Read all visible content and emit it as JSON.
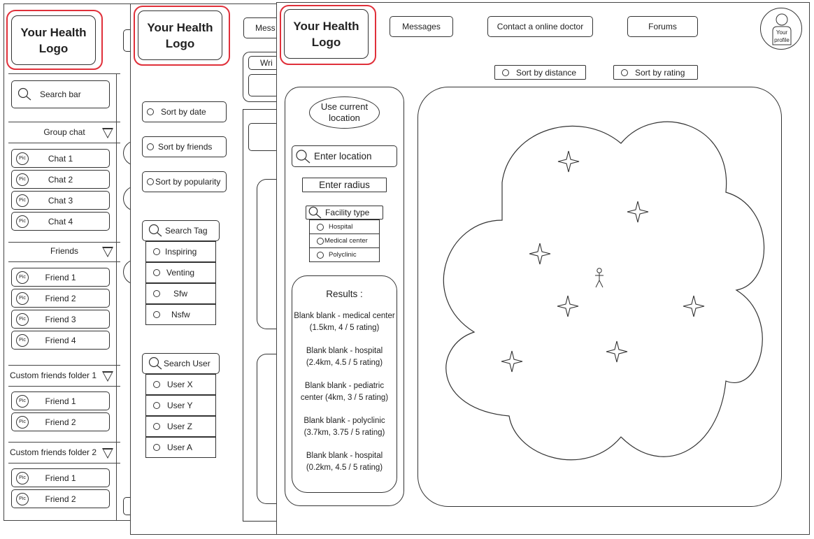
{
  "common": {
    "logo_text": "Your Health Logo"
  },
  "chat_panel": {
    "search_label": "Search bar",
    "pic_label": "Pic",
    "sections": [
      {
        "title": "Group chat",
        "items": [
          "Chat 1",
          "Chat 2",
          "Chat 3",
          "Chat 4"
        ]
      },
      {
        "title": "Friends",
        "items": [
          "Friend 1",
          "Friend 2",
          "Friend 3",
          "Friend 4"
        ]
      },
      {
        "title": "Custom friends folder 1",
        "items": [
          "Friend 1",
          "Friend 2"
        ]
      },
      {
        "title": "Custom friends folder 2",
        "items": [
          "Friend 1",
          "Friend 2"
        ]
      }
    ]
  },
  "forum_panel": {
    "nav_fragment": "Mess",
    "write_fragment": "Wri",
    "sorts": [
      "Sort by date",
      "Sort by friends",
      "Sort by popularity"
    ],
    "tag_search_label": "Search Tag",
    "tags": [
      "Inspiring",
      "Venting",
      "Sfw",
      "Nsfw"
    ],
    "user_search_label": "Search User",
    "users": [
      "User X",
      "User Y",
      "User Z",
      "User A"
    ]
  },
  "map_panel": {
    "nav": {
      "messages": "Messages",
      "contact_doctor": "Contact a online doctor",
      "forums": "Forums",
      "profile_line1": "Your",
      "profile_line2": "profile"
    },
    "sort_distance": "Sort by distance",
    "sort_rating": "Sort by rating",
    "use_location": "Use current location",
    "enter_location": "Enter location",
    "enter_radius": "Enter radius",
    "facility_type": "Facility type",
    "facility_options": [
      "Hospital",
      "Medical center",
      "Polyclinic"
    ],
    "results_title": "Results :",
    "results": [
      "Blank blank - medical center (1.5km, 4 / 5 rating)",
      "Blank blank - hospital (2.4km, 4.5 / 5 rating)",
      "Blank blank - pediatric center (4km, 3 / 5 rating)",
      "Blank blank - polyclinic (3.7km, 3.75 / 5 rating)",
      "Blank blank - hospital (0.2km, 4.5 / 5 rating)"
    ]
  }
}
